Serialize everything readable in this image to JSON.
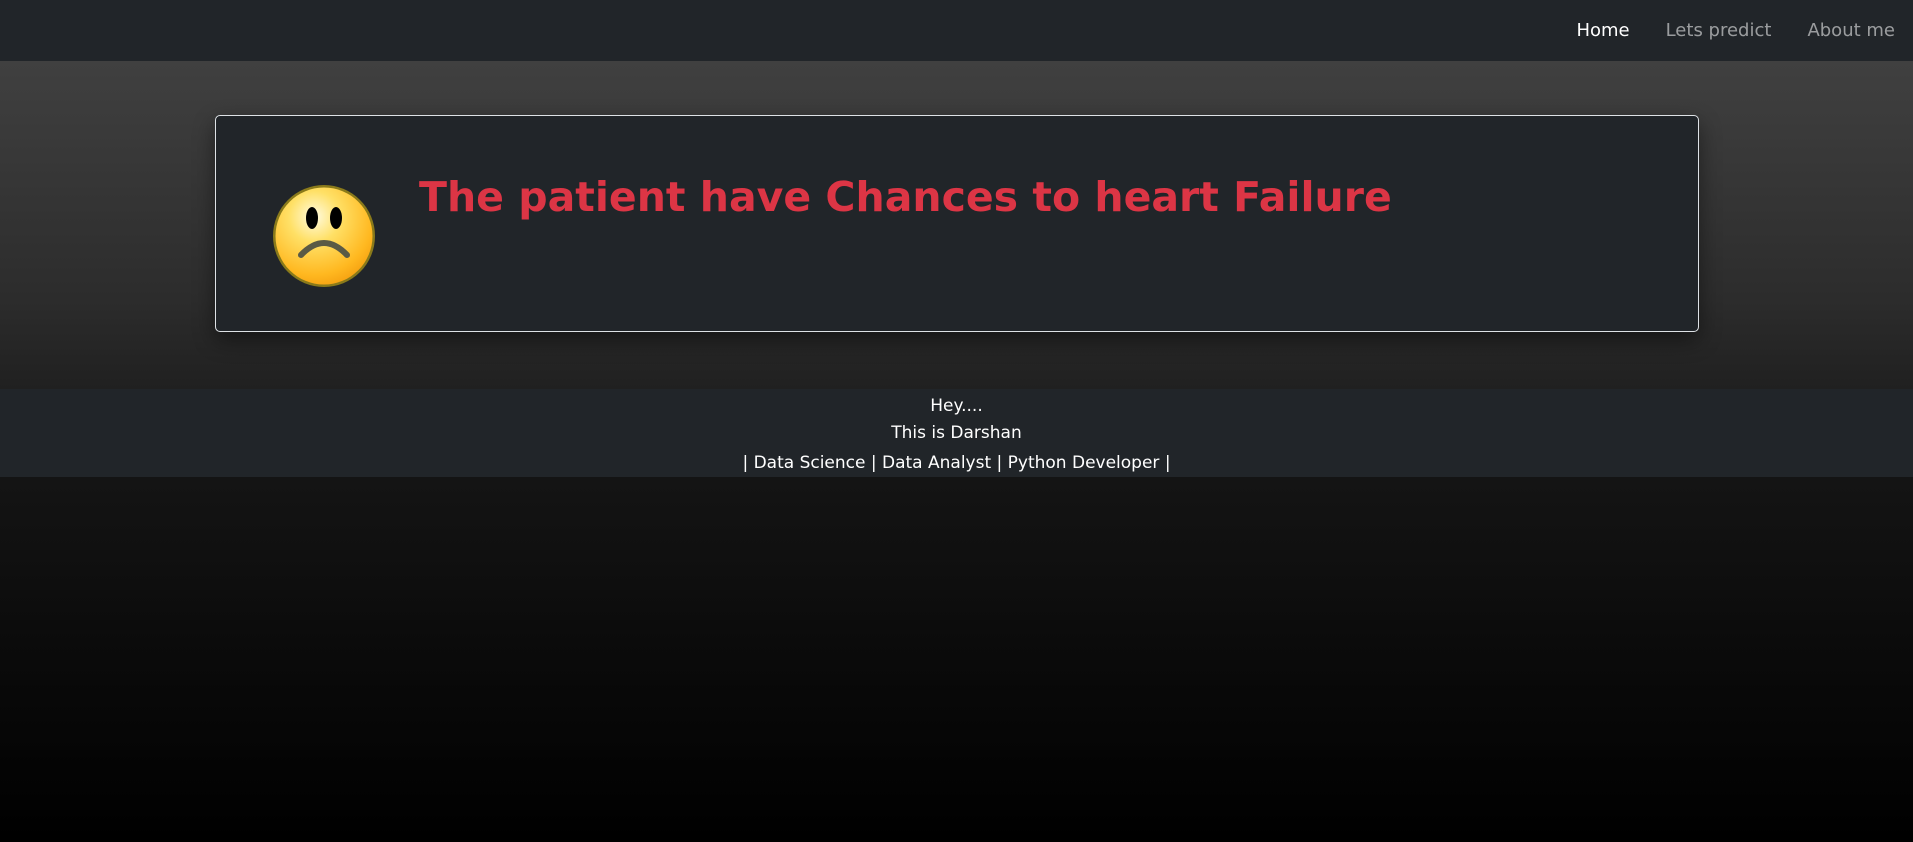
{
  "nav": {
    "items": [
      {
        "label": "Home",
        "active": true
      },
      {
        "label": "Lets predict",
        "active": false
      },
      {
        "label": "About me",
        "active": false
      }
    ]
  },
  "result": {
    "icon": "sad-face-icon",
    "message": "The patient have Chances to heart Failure",
    "message_color": "#dc3545"
  },
  "footer": {
    "greeting": "Hey....",
    "intro": "This is Darshan",
    "roles": "| Data Science | Data Analyst | Python Developer |"
  },
  "colors": {
    "navbar_bg": "#212529",
    "card_bg": "#212529",
    "accent_red": "#dc3545"
  }
}
